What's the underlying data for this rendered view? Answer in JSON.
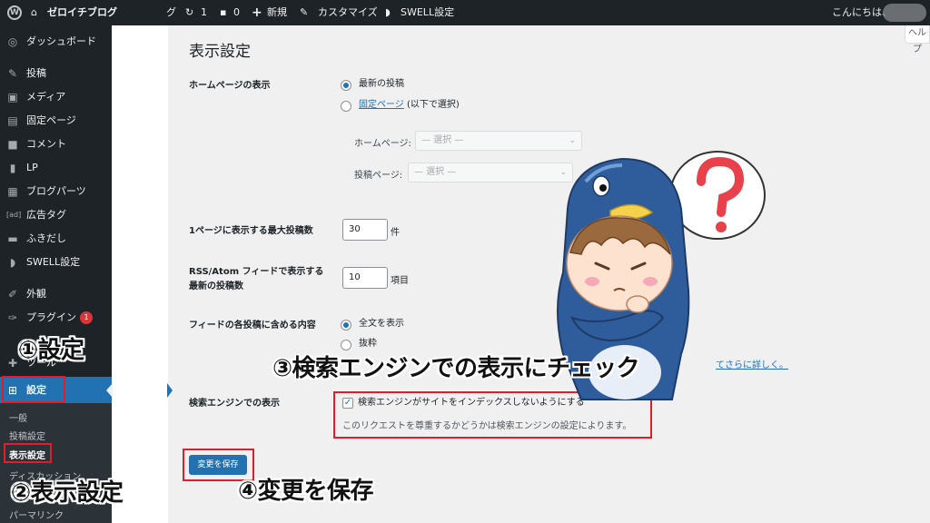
{
  "admin_bar": {
    "wp_logo": "wp-logo-icon",
    "site_name": "ゼロイチブログ",
    "site_name_cut": "グ",
    "updates_count": "1",
    "comments_count": "0",
    "new_label": "新規",
    "customize_label": "カスタマイズ",
    "swell_label": "SWELL設定",
    "greeting": "こんにちは、"
  },
  "sidebar": {
    "items": [
      {
        "icon": "dashboard-icon",
        "glyph": "◎",
        "label": "ダッシュボード"
      },
      {
        "icon": "pin-icon",
        "glyph": "✎",
        "label": "投稿"
      },
      {
        "icon": "media-icon",
        "glyph": "▣",
        "label": "メディア"
      },
      {
        "icon": "page-icon",
        "glyph": "▤",
        "label": "固定ページ"
      },
      {
        "icon": "comment-icon",
        "glyph": "■",
        "label": "コメント"
      },
      {
        "icon": "lp-icon",
        "glyph": "▮",
        "label": "LP"
      },
      {
        "icon": "blog-parts-icon",
        "glyph": "▦",
        "label": "ブログパーツ"
      },
      {
        "icon": "ad-tag-icon",
        "glyph": "[ad]",
        "label": "広告タグ"
      },
      {
        "icon": "balloon-icon",
        "glyph": "▬",
        "label": "ふきだし"
      },
      {
        "icon": "swell-icon",
        "glyph": "◗",
        "label": "SWELL設定"
      },
      {
        "icon": "appearance-icon",
        "glyph": "✐",
        "label": "外観"
      },
      {
        "icon": "plugin-icon",
        "glyph": "✑",
        "label": "プラグイン",
        "badge": "1"
      },
      {
        "icon": "tools-icon",
        "glyph": "✚",
        "label": "ツール"
      },
      {
        "icon": "settings-icon",
        "glyph": "⊞",
        "label": "設定"
      }
    ],
    "submenu": [
      "一般",
      "投稿設定",
      "表示設定",
      "ディスカッション",
      "パーマリンク"
    ]
  },
  "main": {
    "help_label": "ヘルプ",
    "page_title": "表示設定",
    "homepage_display": {
      "label": "ホームページの表示",
      "option_latest": "最新の投稿",
      "option_static_link": "固定ページ",
      "option_static_suffix": "(以下で選択)",
      "homepage_label": "ホームページ:",
      "homepage_placeholder": "— 選択 —",
      "posts_page_label": "投稿ページ:",
      "posts_page_placeholder": "— 選択 —"
    },
    "posts_per_page": {
      "label": "1ページに表示する最大投稿数",
      "value": "30",
      "unit": "件"
    },
    "feed_count": {
      "label_line1": "RSS/Atom フィードで表示する",
      "label_line2": "最新の投稿数",
      "value": "10",
      "unit": "項目"
    },
    "feed_content": {
      "label": "フィードの各投稿に含める内容",
      "option_full": "全文を表示",
      "option_excerpt": "抜粋",
      "more_link": "てさらに詳しく。"
    },
    "search_engine": {
      "label": "検索エンジンでの表示",
      "checkbox_label": "検索エンジンがサイトをインデックスしないようにする",
      "description": "このリクエストを尊重するかどうかは検索エンジンの設定によります。"
    },
    "save_button": "変更を保存"
  },
  "annotations": {
    "step1": "①設定",
    "step2": "②表示設定",
    "step3": "③検索エンジンでの表示にチェック",
    "step4": "④変更を保存"
  },
  "colors": {
    "admin_dark": "#1d2327",
    "accent_blue": "#2271b1",
    "highlight_red": "#e11d2a",
    "badge_red": "#d63638"
  }
}
